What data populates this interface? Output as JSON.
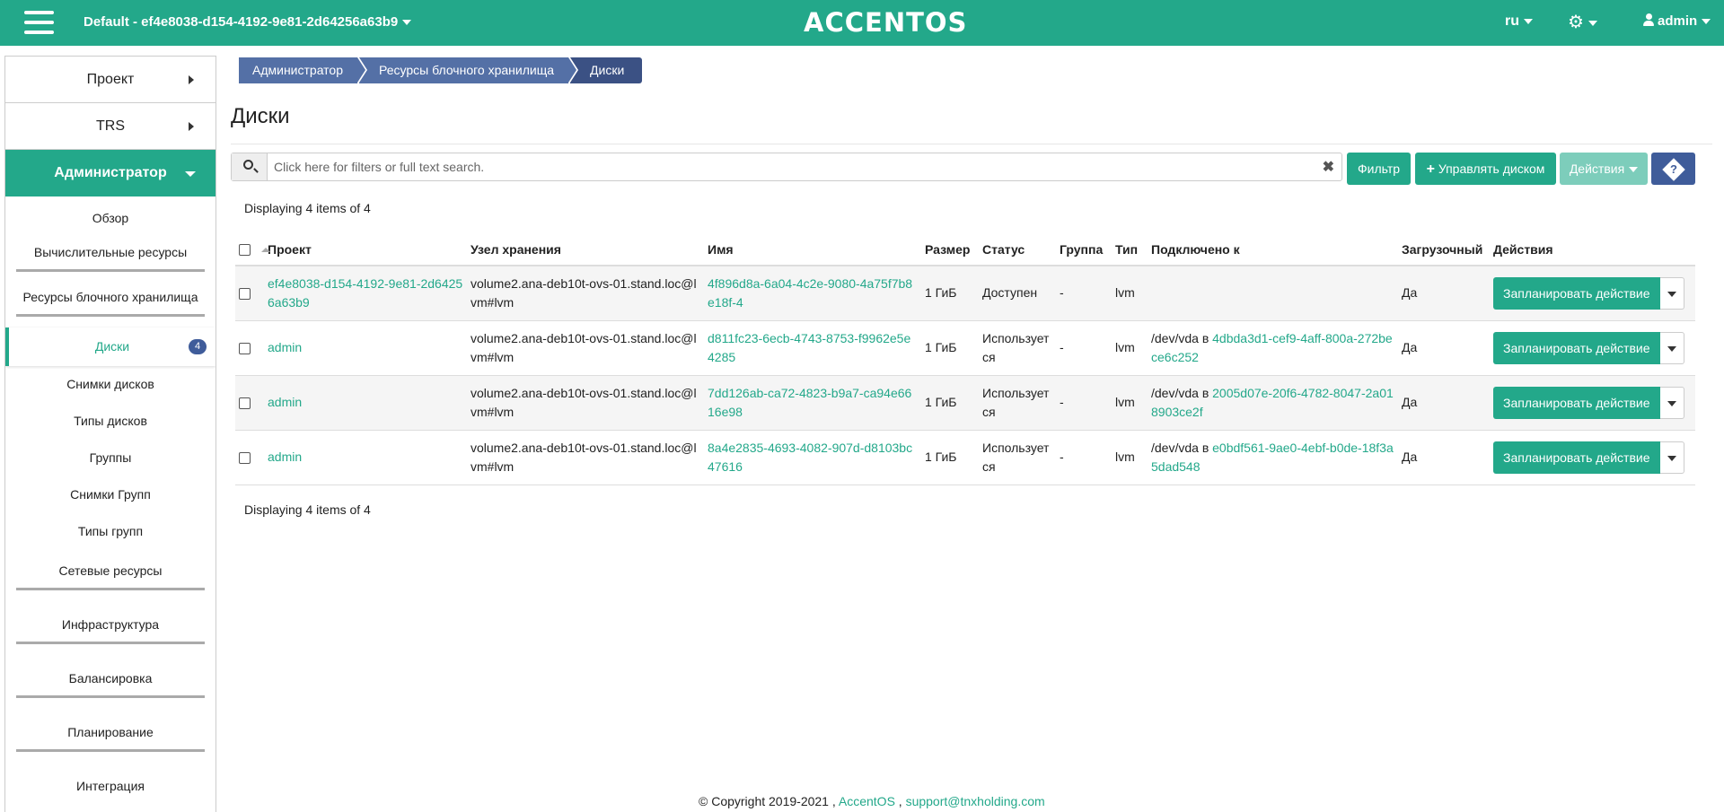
{
  "topbar": {
    "project_selector": "Default - ef4e8038-d154-4192-9e81-2d64256a63b9",
    "logo": "ACCENTOS",
    "language": "ru",
    "user": "admin"
  },
  "sidebar": {
    "sections": [
      {
        "label": "Проект"
      },
      {
        "label": "TRS"
      },
      {
        "label": "Администратор"
      }
    ],
    "admin_items": {
      "overview": "Обзор",
      "compute": "Вычислительные ресурсы",
      "block_storage": "Ресурсы блочного хранилища",
      "volumes": "Диски",
      "volumes_badge": "4",
      "snapshots": "Снимки дисков",
      "volume_types": "Типы дисков",
      "groups": "Группы",
      "group_snapshots": "Снимки Групп",
      "group_types": "Типы групп",
      "network": "Сетевые ресурсы",
      "infrastructure": "Инфраструктура",
      "balancing": "Балансировка",
      "planning": "Планирование",
      "integration": "Интеграция"
    }
  },
  "breadcrumb": [
    "Администратор",
    "Ресурсы блочного хранилища",
    "Диски"
  ],
  "page_title": "Диски",
  "search": {
    "placeholder": "Click here for filters or full text search."
  },
  "toolbar": {
    "filter": "Фильтр",
    "manage": "Управлять диском",
    "actions": "Действия",
    "help": "?"
  },
  "displaying": "Displaying 4 items of 4",
  "table": {
    "headers": [
      "Проект",
      "Узел хранения",
      "Имя",
      "Размер",
      "Статус",
      "Группа",
      "Тип",
      "Подключено к",
      "Загрузочный",
      "Действия"
    ],
    "rows": [
      {
        "project": "ef4e8038-d154-4192-9e81-2d64256a63b9",
        "host": "volume2.ana-deb10t-ovs-01.stand.loc@lvm#lvm",
        "name": "4f896d8a-6a04-4c2e-9080-4a75f7b8e18f-4",
        "size": "1 ГиБ",
        "status": "Доступен",
        "group": "-",
        "type": "lvm",
        "attached_prefix": "",
        "attached_id": "",
        "bootable": "Да",
        "action": "Запланировать действие"
      },
      {
        "project": "admin",
        "host": "volume2.ana-deb10t-ovs-01.stand.loc@lvm#lvm",
        "name": "d811fc23-6ecb-4743-8753-f9962e5e4285",
        "size": "1 ГиБ",
        "status": "Используется",
        "group": "-",
        "type": "lvm",
        "attached_prefix": "/dev/vda в ",
        "attached_id": "4dbda3d1-cef9-4aff-800a-272bece6c252",
        "bootable": "Да",
        "action": "Запланировать действие"
      },
      {
        "project": "admin",
        "host": "volume2.ana-deb10t-ovs-01.stand.loc@lvm#lvm",
        "name": "7dd126ab-ca72-4823-b9a7-ca94e6616e98",
        "size": "1 ГиБ",
        "status": "Используется",
        "group": "-",
        "type": "lvm",
        "attached_prefix": "/dev/vda в ",
        "attached_id": "2005d07e-20f6-4782-8047-2a018903ce2f",
        "bootable": "Да",
        "action": "Запланировать действие"
      },
      {
        "project": "admin",
        "host": "volume2.ana-deb10t-ovs-01.stand.loc@lvm#lvm",
        "name": "8a4e2835-4693-4082-907d-d8103bc47616",
        "size": "1 ГиБ",
        "status": "Используется",
        "group": "-",
        "type": "lvm",
        "attached_prefix": "/dev/vda в ",
        "attached_id": "e0bdf561-9ae0-4ebf-b0de-18f3a5dad548",
        "bootable": "Да",
        "action": "Запланировать действие"
      }
    ]
  },
  "footer": {
    "copyright": "© Copyright 2019-2021 ,",
    "brand": "AccentOS",
    "sep": ",",
    "email": "support@tnxholding.com"
  },
  "colors": {
    "accent": "#23a88a",
    "breadcrumb": "#5470a6",
    "badge": "#3f5c9a"
  }
}
